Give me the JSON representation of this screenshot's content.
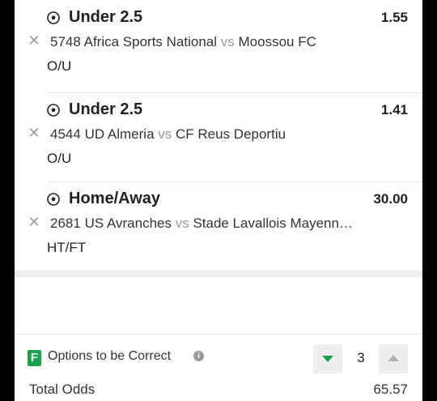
{
  "bets": [
    {
      "pick": "Under 2.5",
      "odds": "1.55",
      "match_id": "5748",
      "home": "Africa Sports National",
      "vs": "vs",
      "away": "Moossou FC",
      "market": "O/U"
    },
    {
      "pick": "Under 2.5",
      "odds": "1.41",
      "match_id": "4544",
      "home": "UD Almeria",
      "vs": "vs",
      "away": "CF Reus Deportiu",
      "market": "O/U"
    },
    {
      "pick": "Home/Away",
      "odds": "30.00",
      "match_id": "2681",
      "home": "US Avranches",
      "vs": "vs",
      "away": "Stade Lavallois Mayenn…",
      "market": "HT/FT"
    }
  ],
  "options": {
    "icon_letter": "F",
    "label": "Options to be Correct",
    "info_glyph": "i",
    "stepper_value": "3"
  },
  "totals": {
    "label": "Total Odds",
    "value": "65.57"
  },
  "colors": {
    "accent": "#1aa34a",
    "remove": "#999999"
  }
}
